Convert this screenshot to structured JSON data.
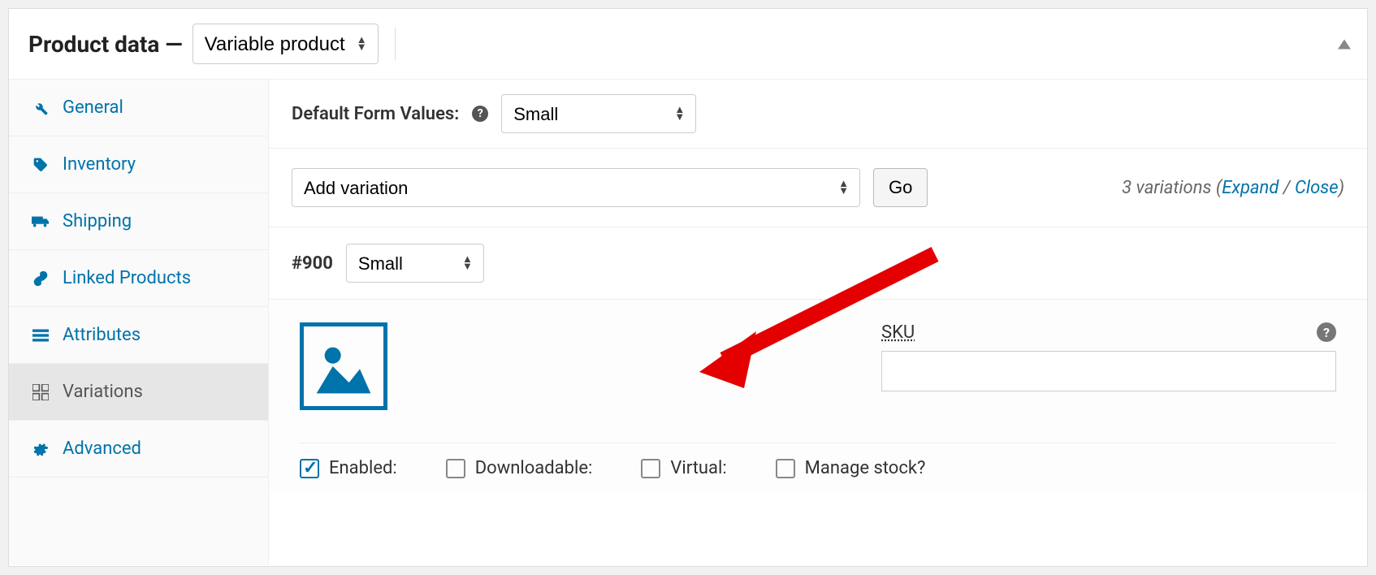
{
  "header": {
    "title": "Product data —",
    "product_type": "Variable product"
  },
  "sidebar": {
    "items": [
      {
        "label": "General"
      },
      {
        "label": "Inventory"
      },
      {
        "label": "Shipping"
      },
      {
        "label": "Linked Products"
      },
      {
        "label": "Attributes"
      },
      {
        "label": "Variations"
      },
      {
        "label": "Advanced"
      }
    ]
  },
  "defaults": {
    "label": "Default Form Values:",
    "value": "Small"
  },
  "toolbar": {
    "action_select": "Add variation",
    "go_label": "Go",
    "count_text": "3 variations",
    "expand": "Expand",
    "close": "Close"
  },
  "variation": {
    "id": "#900",
    "attribute": "Small",
    "sku_label": "SKU",
    "sku_value": "",
    "checkboxes": {
      "enabled": {
        "label": "Enabled:",
        "checked": true
      },
      "downloadable": {
        "label": "Downloadable:",
        "checked": false
      },
      "virtual": {
        "label": "Virtual:",
        "checked": false
      },
      "manage_stock": {
        "label": "Manage stock?",
        "checked": false
      }
    }
  }
}
